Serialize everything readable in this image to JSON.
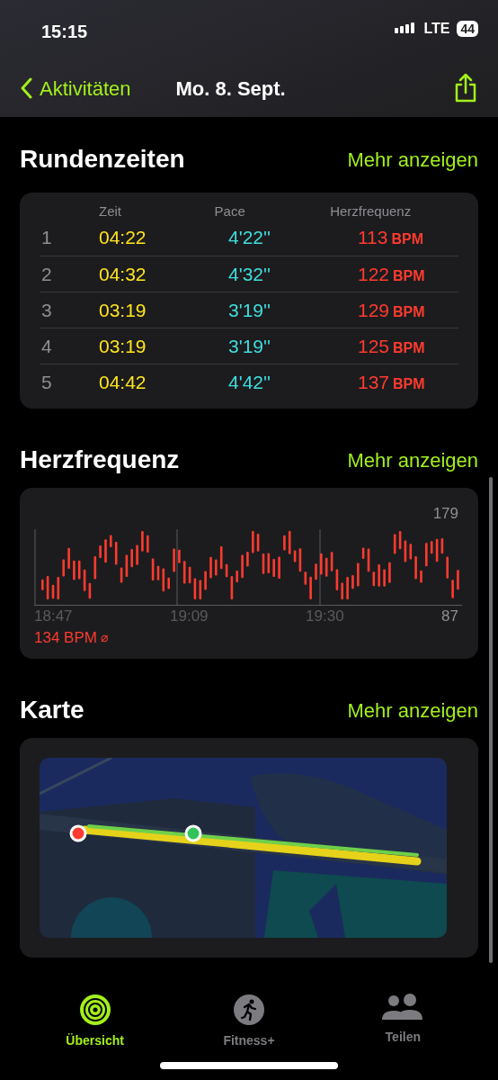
{
  "status_bar": {
    "time": "15:15",
    "network": "LTE",
    "battery": "44"
  },
  "nav": {
    "back": "Aktivitäten",
    "title": "Mo. 8. Sept."
  },
  "laps": {
    "title": "Rundenzeiten",
    "more": "Mehr anzeigen",
    "columns": [
      "Zeit",
      "Pace",
      "Herzfrequenz"
    ],
    "rows": [
      {
        "number": "1",
        "time": "04:22",
        "pace": "4'22''",
        "heart_rate": "113",
        "unit": "BPM"
      },
      {
        "number": "2",
        "time": "04:32",
        "pace": "4'32''",
        "heart_rate": "122",
        "unit": "BPM"
      },
      {
        "number": "3",
        "time": "03:19",
        "pace": "3'19''",
        "heart_rate": "129",
        "unit": "BPM"
      },
      {
        "number": "4",
        "time": "03:19",
        "pace": "3'19''",
        "heart_rate": "125",
        "unit": "BPM"
      },
      {
        "number": "5",
        "time": "04:42",
        "pace": "4'42''",
        "heart_rate": "137",
        "unit": "BPM"
      }
    ]
  },
  "heart_rate": {
    "title": "Herzfrequenz",
    "more": "Mehr anzeigen",
    "max": "179",
    "min": "87",
    "times": [
      "18:47",
      "19:09",
      "19:30"
    ],
    "average": "134 BPM",
    "average_symbol": "⌀"
  },
  "map": {
    "title": "Karte",
    "more": "Mehr anzeigen",
    "kind": "picture"
  },
  "tabs": [
    {
      "label": "Übersicht",
      "kind": "rings",
      "selected": true
    },
    {
      "label": "Fitness+",
      "kind": "runner",
      "selected": false
    },
    {
      "label": "Teilen",
      "kind": "people",
      "selected": false
    }
  ]
}
